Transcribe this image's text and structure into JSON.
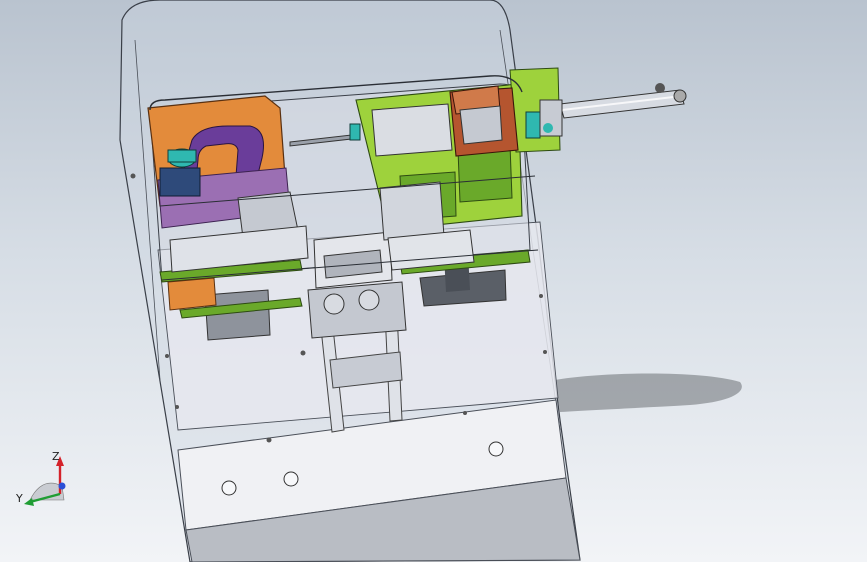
{
  "viewport": {
    "background_top": "#b9c3cf",
    "background_bottom": "#f2f4f7"
  },
  "model": {
    "frame_color": "#c8ccd8",
    "panel_color": "#e9ebf0",
    "sheet_color": "#cfd3da",
    "orange_block": "#e38b3b",
    "purple_block": "#9b6fb3",
    "green_block": "#9ed23c",
    "dark_green_block": "#6aa92a",
    "brown_block": "#b5552f",
    "teal_part": "#2fb8b0",
    "navy_part": "#2e4a7a",
    "gray_part": "#8e939c",
    "dark_part": "#5a5f67",
    "cylinder": "#d7dbe2"
  },
  "triad": {
    "z_label": "Z",
    "y_label": "Y",
    "z_color": "#d4222a",
    "y_color": "#1f9d34",
    "x_color": "#2b4fd6"
  }
}
